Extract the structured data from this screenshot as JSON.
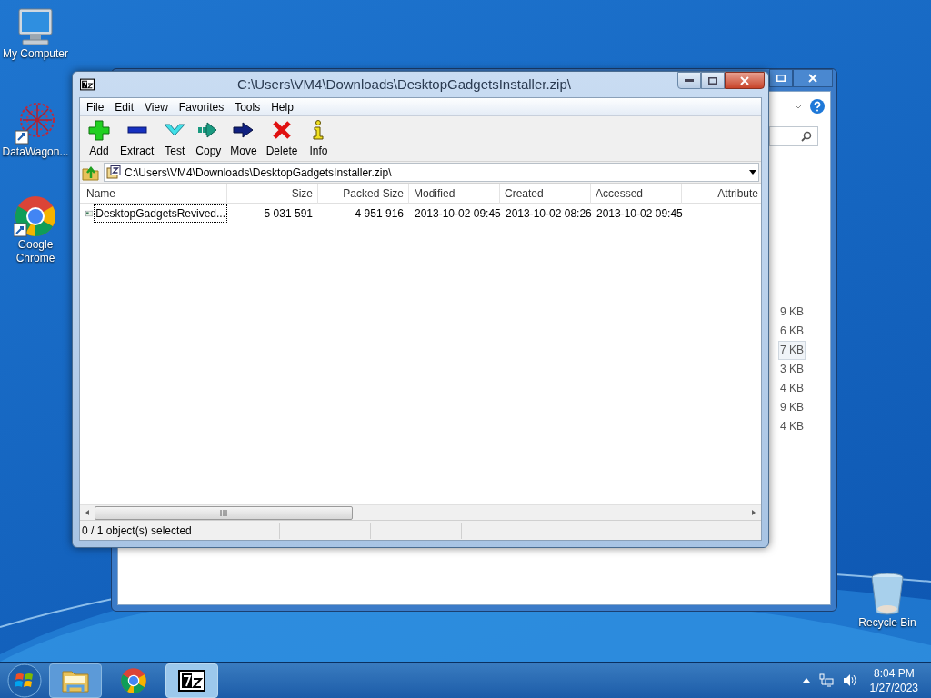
{
  "desktop_icons": [
    {
      "kind": "computer",
      "label": "My Computer"
    },
    {
      "kind": "datawagon",
      "label": "DataWagon..."
    },
    {
      "kind": "chrome",
      "label": "Google Chrome"
    }
  ],
  "recycle_bin": {
    "label": "Recycle Bin"
  },
  "explorer_window": {
    "sizes": [
      {
        "text": "9 KB",
        "selected": false
      },
      {
        "text": "6 KB",
        "selected": false
      },
      {
        "text": "7 KB",
        "selected": true
      },
      {
        "text": "3 KB",
        "selected": false
      },
      {
        "text": "4 KB",
        "selected": false
      },
      {
        "text": "9 KB",
        "selected": false
      },
      {
        "text": "4 KB",
        "selected": false
      }
    ]
  },
  "archive_window": {
    "title": "C:\\Users\\VM4\\Downloads\\DesktopGadgetsInstaller.zip\\",
    "menu": [
      "File",
      "Edit",
      "View",
      "Favorites",
      "Tools",
      "Help"
    ],
    "toolbar": [
      {
        "kind": "add",
        "label": "Add"
      },
      {
        "kind": "extract",
        "label": "Extract"
      },
      {
        "kind": "test",
        "label": "Test"
      },
      {
        "kind": "copy",
        "label": "Copy"
      },
      {
        "kind": "move",
        "label": "Move"
      },
      {
        "kind": "delete",
        "label": "Delete"
      },
      {
        "kind": "info",
        "label": "Info"
      }
    ],
    "address": "C:\\Users\\VM4\\Downloads\\DesktopGadgetsInstaller.zip\\",
    "columns": [
      "Name",
      "Size",
      "Packed Size",
      "Modified",
      "Created",
      "Accessed",
      "Attribute"
    ],
    "rows": [
      {
        "cells": [
          "DesktopGadgetsRevived...",
          "5 031 591",
          "4 951 916",
          "2013-10-02 09:45",
          "2013-10-02 08:26",
          "2013-10-02 09:45"
        ],
        "selected": false,
        "focused": true
      }
    ],
    "status_bar": [
      "0 / 1 object(s) selected"
    ]
  },
  "taskbar": {
    "items": [
      {
        "kind": "explorer",
        "active": false
      },
      {
        "kind": "chrome",
        "active": false
      },
      {
        "kind": "sevenzip",
        "active": true
      }
    ],
    "clock": {
      "time": "8:04 PM",
      "date": "1/27/2023"
    }
  }
}
